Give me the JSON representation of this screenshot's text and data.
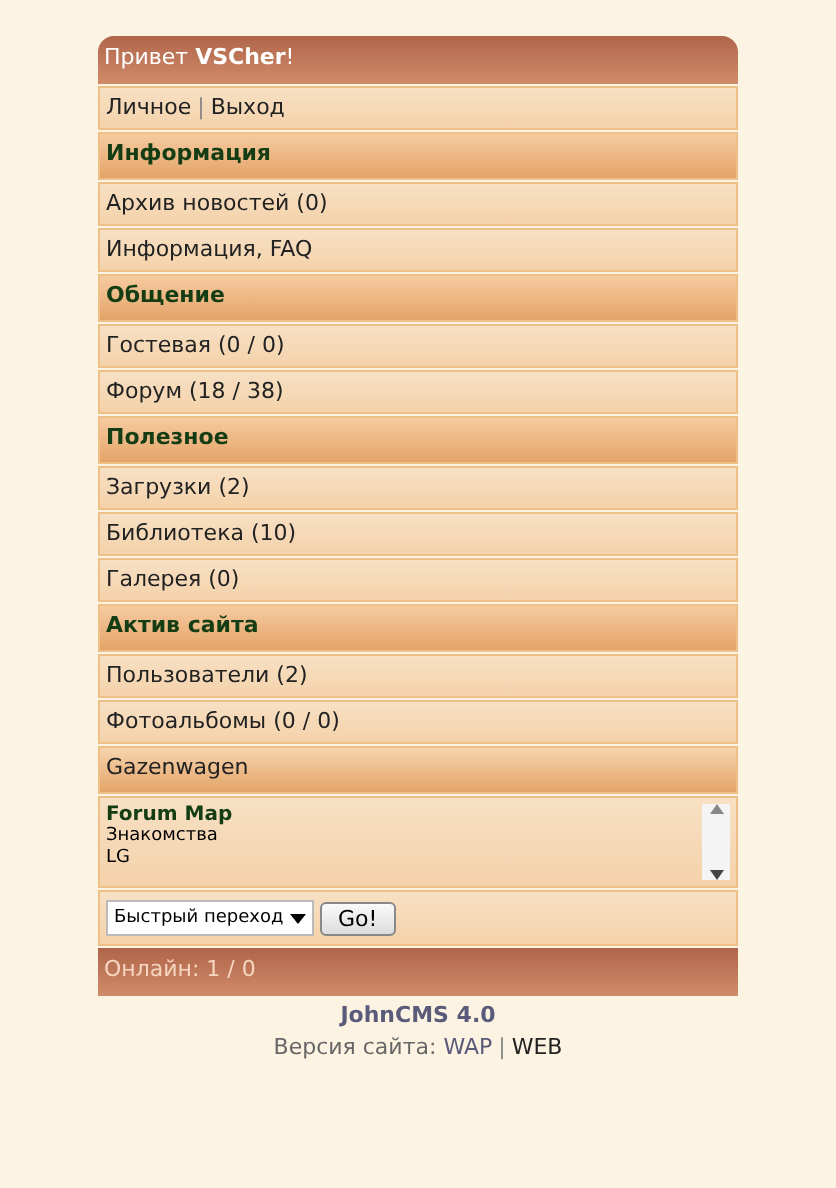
{
  "greeting": {
    "text": "Привет **VSCher**!"
  },
  "user_links": [
    {
      "label": "Личное"
    },
    {
      "label": "Выход"
    }
  ],
  "separator": "|",
  "menu": [
    {
      "kind": "header",
      "label": "Информация"
    },
    {
      "kind": "link",
      "label": "Архив новостей (0)"
    },
    {
      "kind": "link",
      "label": "Информация, FAQ"
    },
    {
      "kind": "header",
      "label": "Общение"
    },
    {
      "kind": "link",
      "label": "Гостевая (0 / 0)"
    },
    {
      "kind": "link",
      "label": "Форум (18 / 38)"
    },
    {
      "kind": "header",
      "label": "Полезное"
    },
    {
      "kind": "link",
      "label": "Загрузки (2)"
    },
    {
      "kind": "link",
      "label": "Библиотека (10)"
    },
    {
      "kind": "link",
      "label": "Галерея (0)"
    },
    {
      "kind": "header",
      "label": "Актив сайта"
    },
    {
      "kind": "link",
      "label": "Пользователи (2)"
    },
    {
      "kind": "link",
      "label": "Фотоальбомы (0 / 0)"
    },
    {
      "kind": "banner",
      "label": "Gazenwagen"
    }
  ],
  "ticker": {
    "title": "Forum Map",
    "lines": [
      "Знакомства",
      "LG"
    ]
  },
  "quick_jump": {
    "value": "Быстрый переход",
    "button": "Go!"
  },
  "footer": {
    "online": "Онлайн: 1 / 0"
  },
  "copyright": {
    "title": "JohnCMS 4.0",
    "version_label": "Версия сайта:",
    "links": [
      {
        "label": "WAP",
        "selected": false
      },
      {
        "label": "WEB",
        "selected": true
      }
    ]
  }
}
